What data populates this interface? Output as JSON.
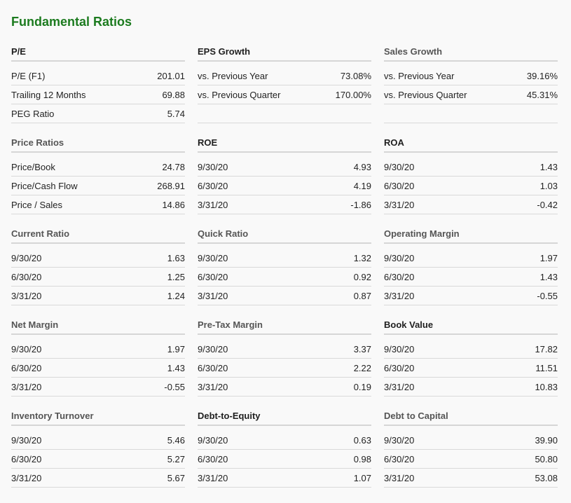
{
  "title": "Fundamental Ratios",
  "colors": {
    "title": "#1c7b1f",
    "header_text": "#555555",
    "divider": "#d6d6d6",
    "background": "#f9f9f9"
  },
  "sections": [
    {
      "title": "P/E",
      "rows": [
        {
          "label": "P/E (F1)",
          "value": "201.01"
        },
        {
          "label": "Trailing 12 Months",
          "value": "69.88"
        },
        {
          "label": "PEG Ratio",
          "value": "5.74"
        }
      ]
    },
    {
      "title": "EPS Growth",
      "rows": [
        {
          "label": "vs. Previous Year",
          "value": "73.08%"
        },
        {
          "label": "vs. Previous Quarter",
          "value": "170.00%"
        },
        {
          "label": "",
          "value": ""
        }
      ]
    },
    {
      "title": "Sales Growth",
      "rows": [
        {
          "label": "vs. Previous Year",
          "value": "39.16%"
        },
        {
          "label": "vs. Previous Quarter",
          "value": "45.31%"
        },
        {
          "label": "",
          "value": ""
        }
      ]
    },
    {
      "title": "Price Ratios",
      "rows": [
        {
          "label": "Price/Book",
          "value": "24.78"
        },
        {
          "label": "Price/Cash Flow",
          "value": "268.91"
        },
        {
          "label": "Price / Sales",
          "value": "14.86"
        }
      ]
    },
    {
      "title": "ROE",
      "rows": [
        {
          "label": "9/30/20",
          "value": "4.93"
        },
        {
          "label": "6/30/20",
          "value": "4.19"
        },
        {
          "label": "3/31/20",
          "value": "-1.86"
        }
      ]
    },
    {
      "title": "ROA",
      "rows": [
        {
          "label": "9/30/20",
          "value": "1.43"
        },
        {
          "label": "6/30/20",
          "value": "1.03"
        },
        {
          "label": "3/31/20",
          "value": "-0.42"
        }
      ]
    },
    {
      "title": "Current Ratio",
      "rows": [
        {
          "label": "9/30/20",
          "value": "1.63"
        },
        {
          "label": "6/30/20",
          "value": "1.25"
        },
        {
          "label": "3/31/20",
          "value": "1.24"
        }
      ]
    },
    {
      "title": "Quick Ratio",
      "rows": [
        {
          "label": "9/30/20",
          "value": "1.32"
        },
        {
          "label": "6/30/20",
          "value": "0.92"
        },
        {
          "label": "3/31/20",
          "value": "0.87"
        }
      ]
    },
    {
      "title": "Operating Margin",
      "rows": [
        {
          "label": "9/30/20",
          "value": "1.97"
        },
        {
          "label": "6/30/20",
          "value": "1.43"
        },
        {
          "label": "3/31/20",
          "value": "-0.55"
        }
      ]
    },
    {
      "title": "Net Margin",
      "rows": [
        {
          "label": "9/30/20",
          "value": "1.97"
        },
        {
          "label": "6/30/20",
          "value": "1.43"
        },
        {
          "label": "3/31/20",
          "value": "-0.55"
        }
      ]
    },
    {
      "title": "Pre-Tax Margin",
      "rows": [
        {
          "label": "9/30/20",
          "value": "3.37"
        },
        {
          "label": "6/30/20",
          "value": "2.22"
        },
        {
          "label": "3/31/20",
          "value": "0.19"
        }
      ]
    },
    {
      "title": "Book Value",
      "rows": [
        {
          "label": "9/30/20",
          "value": "17.82"
        },
        {
          "label": "6/30/20",
          "value": "11.51"
        },
        {
          "label": "3/31/20",
          "value": "10.83"
        }
      ]
    },
    {
      "title": "Inventory Turnover",
      "rows": [
        {
          "label": "9/30/20",
          "value": "5.46"
        },
        {
          "label": "6/30/20",
          "value": "5.27"
        },
        {
          "label": "3/31/20",
          "value": "5.67"
        }
      ]
    },
    {
      "title": "Debt-to-Equity",
      "rows": [
        {
          "label": "9/30/20",
          "value": "0.63"
        },
        {
          "label": "6/30/20",
          "value": "0.98"
        },
        {
          "label": "3/31/20",
          "value": "1.07"
        }
      ]
    },
    {
      "title": "Debt to Capital",
      "rows": [
        {
          "label": "9/30/20",
          "value": "39.90"
        },
        {
          "label": "6/30/20",
          "value": "50.80"
        },
        {
          "label": "3/31/20",
          "value": "53.08"
        }
      ]
    }
  ]
}
